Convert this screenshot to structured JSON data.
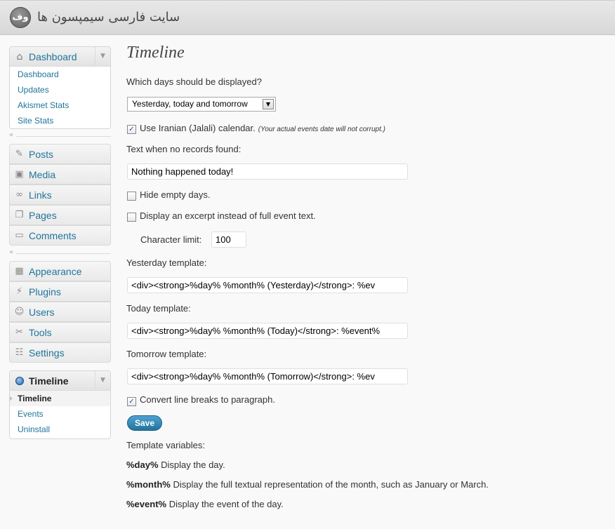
{
  "header": {
    "logo_text": "وف",
    "site_title": "سایت فارسی سیمپسون ها"
  },
  "sidebar": {
    "dashboard": {
      "label": "Dashboard",
      "submenu": [
        "Dashboard",
        "Updates",
        "Akismet Stats",
        "Site Stats"
      ]
    },
    "group1": [
      {
        "label": "Posts",
        "icon": "pin-icon"
      },
      {
        "label": "Media",
        "icon": "media-icon"
      },
      {
        "label": "Links",
        "icon": "link-icon"
      },
      {
        "label": "Pages",
        "icon": "pages-icon"
      },
      {
        "label": "Comments",
        "icon": "comment-icon"
      }
    ],
    "group2": [
      {
        "label": "Appearance",
        "icon": "appearance-icon"
      },
      {
        "label": "Plugins",
        "icon": "plugin-icon"
      },
      {
        "label": "Users",
        "icon": "users-icon"
      },
      {
        "label": "Tools",
        "icon": "tools-icon"
      },
      {
        "label": "Settings",
        "icon": "settings-icon"
      }
    ],
    "timeline": {
      "label": "Timeline",
      "submenu": [
        "Timeline",
        "Events",
        "Uninstall"
      ]
    }
  },
  "main": {
    "title": "Timeline",
    "days_question": "Which days should be displayed?",
    "days_select": "Yesterday, today and tomorrow",
    "jalali_label": "Use Iranian (Jalali) calendar.",
    "jalali_note": "(Your actual events date will not corrupt.)",
    "jalali_checked": true,
    "no_records_label": "Text when no records found:",
    "no_records_value": "Nothing happened today!",
    "hide_empty_label": "Hide empty days.",
    "hide_empty_checked": false,
    "excerpt_label": "Display an excerpt instead of full event text.",
    "excerpt_checked": false,
    "char_limit_label": "Character limit:",
    "char_limit_value": "100",
    "yesterday_label": "Yesterday template:",
    "yesterday_value": "<div><strong>%day% %month% (Yesterday)</strong>: %ev",
    "today_label": "Today template:",
    "today_value": "<div><strong>%day% %month% (Today)</strong>: %event%",
    "tomorrow_label": "Tomorrow template:",
    "tomorrow_value": "<div><strong>%day% %month% (Tomorrow)</strong>: %ev",
    "linebreaks_label": "Convert line breaks to paragraph.",
    "linebreaks_checked": true,
    "save_label": "Save",
    "vars_title": "Template variables:",
    "vars": [
      {
        "name": "%day%",
        "desc": "Display the day."
      },
      {
        "name": "%month%",
        "desc": "Display the full textual representation of the month, such as January or March."
      },
      {
        "name": "%event%",
        "desc": "Display the event of the day."
      }
    ]
  }
}
